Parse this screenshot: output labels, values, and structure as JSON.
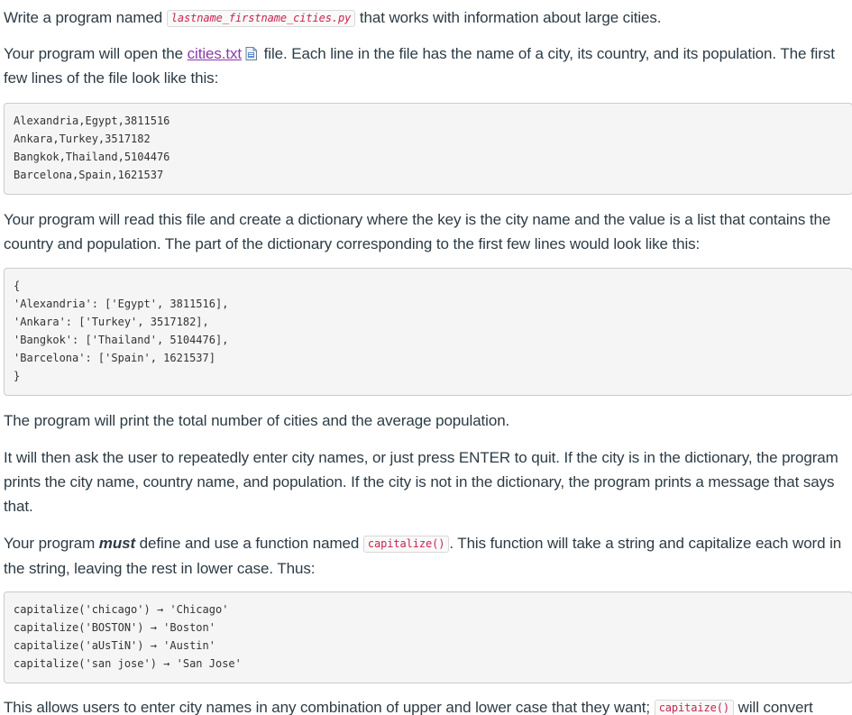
{
  "p1": {
    "before": "Write a program named ",
    "filename": "lastname_firstname_cities.py",
    "after": " that works with information about large cities."
  },
  "p2": {
    "before": "Your program will open the ",
    "link": "cities.txt",
    "icon": "file-icon",
    "after": " file. Each line in the file has the name of a city, its country, and its population. The first few lines of the file look like this:"
  },
  "code_block_1": [
    "Alexandria,Egypt,3811516",
    "Ankara,Turkey,3517182",
    "Bangkok,Thailand,5104476",
    "Barcelona,Spain,1621537"
  ],
  "p3": "Your program will read this file and create a dictionary where the key is the city name and the value is a list that contains the country and population. The part of the dictionary corresponding to the first few lines would look like this:",
  "code_block_2": [
    "{",
    "'Alexandria': ['Egypt', 3811516],",
    "'Ankara': ['Turkey', 3517182],",
    "'Bangkok': ['Thailand', 5104476],",
    "'Barcelona': ['Spain', 1621537]",
    "}"
  ],
  "p4": "The program will print the total number of cities and the average population.",
  "p5": "It will then ask the user to repeatedly enter city names, or just press ENTER to quit. If the city is in the dictionary, the program prints the city name, country name, and population. If the city is not in the dictionary, the program prints a message that says that.",
  "p6": {
    "before": "Your program ",
    "must": "must",
    "middle": " define and use a function named ",
    "func": "capitalize()",
    "after": ". This function will take a string and capitalize each word in the string, leaving the rest in lower case. Thus:"
  },
  "code_block_3": [
    "capitalize('chicago') → 'Chicago'",
    "capitalize('BOSTON') → 'Boston'",
    "capitalize('aUsTiN') → 'Austin'",
    "capitalize('san jose') → 'San Jose'"
  ],
  "p7": {
    "before": "This allows users to enter city names in any combination of upper and lower case that they want; ",
    "func": "capitaize()",
    "after": " will convert"
  }
}
